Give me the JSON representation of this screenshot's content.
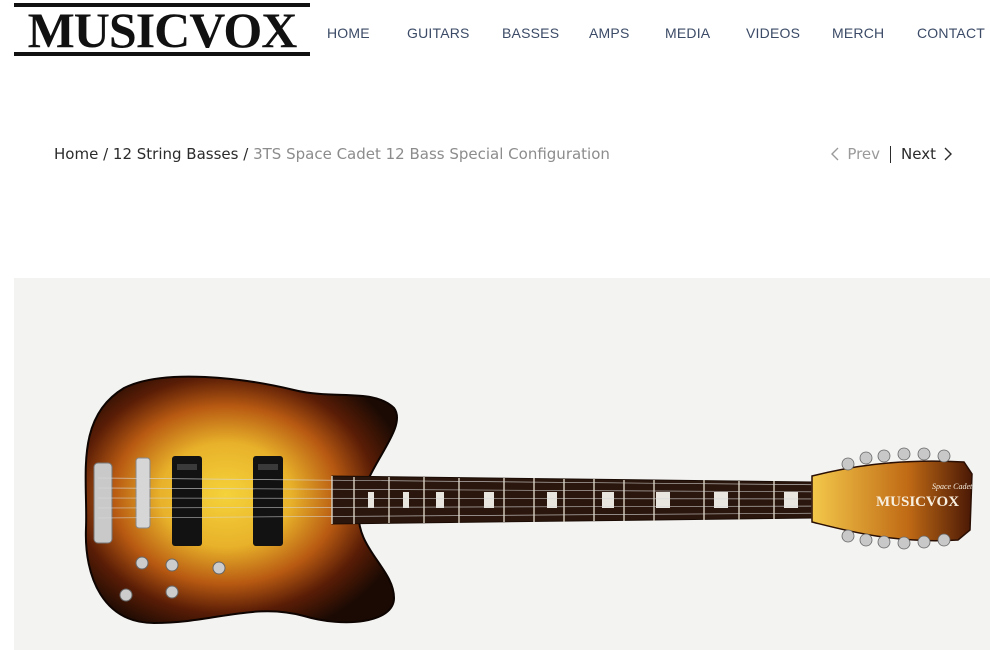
{
  "brand": {
    "name": "MUSICVOX"
  },
  "nav": {
    "items": [
      {
        "label": "HOME"
      },
      {
        "label": "GUITARS"
      },
      {
        "label": "BASSES"
      },
      {
        "label": "AMPS"
      },
      {
        "label": "MEDIA"
      },
      {
        "label": "VIDEOS"
      },
      {
        "label": "MERCH"
      },
      {
        "label": "CONTACT"
      }
    ]
  },
  "breadcrumb": {
    "home": "Home",
    "separator": "/",
    "category": "12 String Basses",
    "current": "3TS Space Cadet 12 Bass Special Configuration"
  },
  "pager": {
    "prev": "Prev",
    "next": "Next"
  },
  "product": {
    "headstock_brand": "MUSICVOX",
    "headstock_model": "Space Cadet",
    "icon": "guitar-image"
  },
  "colors": {
    "nav_text": "#3b4a66",
    "breadcrumb_current": "#8c8c8c",
    "image_background": "#f3f3f2"
  }
}
